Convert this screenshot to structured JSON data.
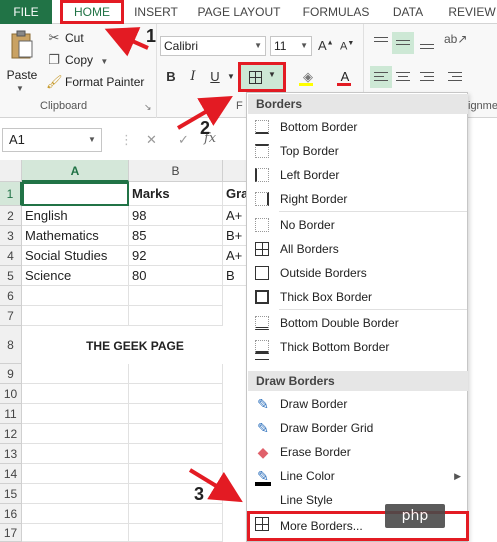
{
  "ribbon_tabs": {
    "file": "FILE",
    "home": "HOME",
    "insert": "INSERT",
    "page_layout": "PAGE LAYOUT",
    "formulas": "FORMULAS",
    "data": "DATA",
    "review": "REVIEW"
  },
  "clipboard": {
    "paste": "Paste",
    "cut": "Cut",
    "copy": "Copy",
    "format_painter": "Format Painter",
    "group_label": "Clipboard",
    "icons": {
      "cut": "scissors-icon",
      "copy": "copy-icon",
      "format_painter": "paintbrush-icon"
    }
  },
  "font": {
    "name": "Calibri",
    "size": "11",
    "bold": "B",
    "italic": "I",
    "underline": "U",
    "group_label": "F",
    "font_color_letter": "A"
  },
  "alignment": {
    "group_label": "ignme"
  },
  "formula_bar": {
    "name_box": "A1",
    "cancel": "✕",
    "enter": "✓",
    "fx": "fx"
  },
  "sheet": {
    "columns": [
      "A",
      "B",
      "Gra"
    ],
    "rows": [
      "1",
      "2",
      "3",
      "4",
      "5",
      "6",
      "7",
      "8",
      "9",
      "10",
      "11",
      "12",
      "13",
      "14",
      "15",
      "16",
      "17"
    ],
    "header_row": [
      "",
      "Marks",
      "Gra"
    ],
    "data": [
      [
        "English",
        "98",
        "A+"
      ],
      [
        "Mathematics",
        "85",
        "B+"
      ],
      [
        "Social Studies",
        "92",
        "A+"
      ],
      [
        "Science",
        "80",
        "B"
      ]
    ],
    "title": "THE GEEK PAGE"
  },
  "borders_menu": {
    "header": "Borders",
    "items": [
      "Bottom Border",
      "Top Border",
      "Left Border",
      "Right Border",
      "No Border",
      "All Borders",
      "Outside Borders",
      "Thick Box Border",
      "Bottom Double Border",
      "Thick Bottom Border"
    ],
    "draw_header": "Draw Borders",
    "draw_items": [
      "Draw Border",
      "Draw Border Grid",
      "Erase Border",
      "Line Color",
      "Line Style"
    ],
    "more": "More Borders..."
  },
  "annotations": {
    "step1": "1",
    "step2": "2",
    "step3": "3",
    "highlight_color": "#e31b23"
  },
  "watermark": "php",
  "colors": {
    "excel_green": "#217346",
    "selection_fill": "#cde8d5"
  }
}
